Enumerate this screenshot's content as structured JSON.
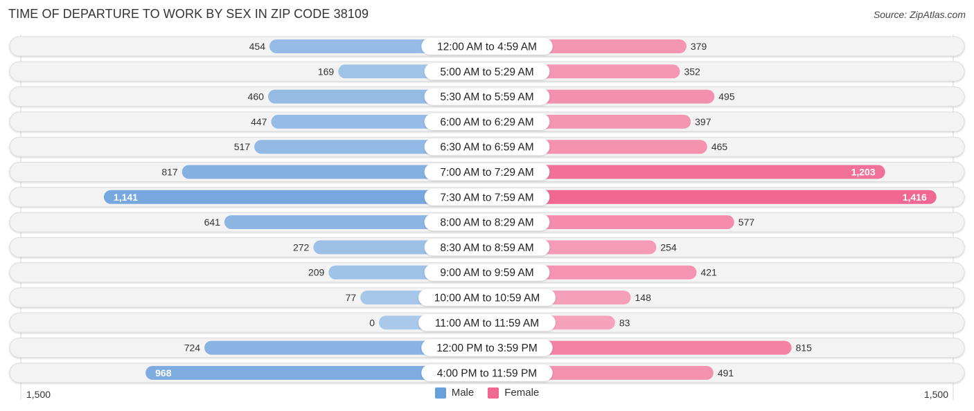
{
  "title": "TIME OF DEPARTURE TO WORK BY SEX IN ZIP CODE 38109",
  "source": "Source: ZipAtlas.com",
  "colors": {
    "male": "#6a9fdc",
    "male_light": "#a9c8ea",
    "female": "#f06892",
    "female_light": "#f6a6bf"
  },
  "legend": [
    {
      "label": "Male",
      "color": "#6a9fdc"
    },
    {
      "label": "Female",
      "color": "#f06892"
    }
  ],
  "axis": {
    "left_label": "1,500",
    "right_label": "1,500"
  },
  "chart_data": {
    "type": "bar",
    "orientation": "horizontal-diverging",
    "title": "TIME OF DEPARTURE TO WORK BY SEX IN ZIP CODE 38109",
    "categories": [
      "12:00 AM to 4:59 AM",
      "5:00 AM to 5:29 AM",
      "5:30 AM to 5:59 AM",
      "6:00 AM to 6:29 AM",
      "6:30 AM to 6:59 AM",
      "7:00 AM to 7:29 AM",
      "7:30 AM to 7:59 AM",
      "8:00 AM to 8:29 AM",
      "8:30 AM to 8:59 AM",
      "9:00 AM to 9:59 AM",
      "10:00 AM to 10:59 AM",
      "11:00 AM to 11:59 AM",
      "12:00 PM to 3:59 PM",
      "4:00 PM to 11:59 PM"
    ],
    "series": [
      {
        "name": "Male",
        "values": [
          454,
          169,
          460,
          447,
          517,
          817,
          1141,
          641,
          272,
          209,
          77,
          0,
          724,
          968
        ],
        "labels": [
          "454",
          "169",
          "460",
          "447",
          "517",
          "817",
          "1,141",
          "641",
          "272",
          "209",
          "77",
          "0",
          "724",
          "968"
        ]
      },
      {
        "name": "Female",
        "values": [
          379,
          352,
          495,
          397,
          465,
          1203,
          1416,
          577,
          254,
          421,
          148,
          83,
          815,
          491
        ],
        "labels": [
          "379",
          "352",
          "495",
          "397",
          "465",
          "1,203",
          "1,416",
          "577",
          "254",
          "421",
          "148",
          "83",
          "815",
          "491"
        ]
      }
    ],
    "xlim": [
      -1500,
      1500
    ],
    "xlabel": "",
    "ylabel": "",
    "legend_position": "bottom-center",
    "grid": false
  }
}
